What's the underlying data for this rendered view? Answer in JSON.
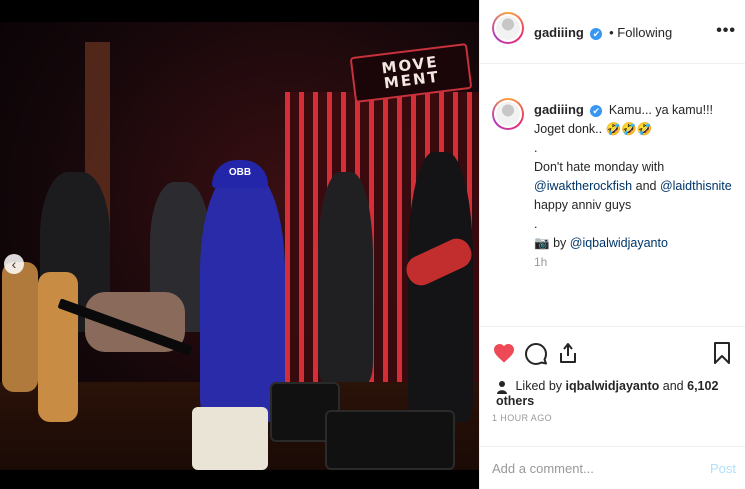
{
  "photo": {
    "sign_line1": "MOVE",
    "sign_line2": "MENT",
    "cap_text": "OBB"
  },
  "header": {
    "username": "gadiiing",
    "verified_mark": "✔",
    "separator": "•",
    "follow_status": "Following",
    "more_icon": "more-dots-icon"
  },
  "caption": {
    "username": "gadiiing",
    "line1": "Kamu... ya kamu!!! Joget donk.. 🤣🤣🤣",
    "dot1": ".",
    "line2": "Don't hate monday with",
    "mention1": "@iwaktherockfish",
    "and": "and",
    "mention2": "@laidthisnite",
    "line3": "happy anniv guys",
    "dot2": ".",
    "credit_icon": "📷",
    "credit_prefix": "by",
    "credit_mention": "@iqbalwidjayanto",
    "time_ago": "1h"
  },
  "actions": {
    "like_icon": "heart-filled-icon",
    "comment_icon": "comment-icon",
    "share_icon": "share-icon",
    "save_icon": "bookmark-icon",
    "liked_prefix": "Liked by",
    "liked_user": "iqbalwidjayanto",
    "liked_and": "and",
    "liked_others": "6,102 others",
    "post_age": "1 HOUR AGO"
  },
  "comment": {
    "placeholder": "Add a comment...",
    "post_label": "Post"
  },
  "colors": {
    "like_red": "#ed4956",
    "link_blue": "#003569",
    "verified_blue": "#3897f0",
    "post_disabled": "#b2dffc"
  }
}
